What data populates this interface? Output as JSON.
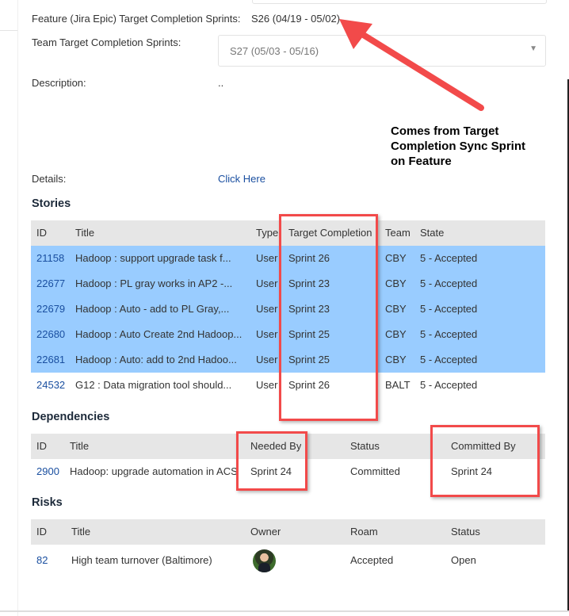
{
  "fields": {
    "feature_label": "Feature (Jira Epic) Target Completion Sprints:",
    "feature_value": "S26 (04/19 - 05/02)",
    "team_label": "Team Target Completion Sprints:",
    "team_value": "S27 (05/03 - 05/16)",
    "description_label": "Description:",
    "description_value": "..",
    "details_label": "Details:",
    "details_link": "Click Here"
  },
  "annotation": {
    "text": "Comes from Target Completion Sync Sprint on Feature",
    "color": "#f24a4a"
  },
  "stories": {
    "title": "Stories",
    "columns": [
      "ID",
      "Title",
      "Type",
      "Target Completion",
      "Team",
      "State"
    ],
    "rows": [
      {
        "id": "21158",
        "title": "Hadoop : support upgrade task f...",
        "type": "User",
        "target": "Sprint 26",
        "team": "CBY",
        "state": "5 - Accepted",
        "selected": true
      },
      {
        "id": "22677",
        "title": "Hadoop : PL gray works in AP2 -...",
        "type": "User",
        "target": "Sprint 23",
        "team": "CBY",
        "state": "5 - Accepted",
        "selected": true
      },
      {
        "id": "22679",
        "title": "Hadoop : Auto - add to PL Gray,...",
        "type": "User",
        "target": "Sprint 23",
        "team": "CBY",
        "state": "5 - Accepted",
        "selected": true
      },
      {
        "id": "22680",
        "title": "Hadoop : Auto Create 2nd Hadoop...",
        "type": "User",
        "target": "Sprint 25",
        "team": "CBY",
        "state": "5 - Accepted",
        "selected": true
      },
      {
        "id": "22681",
        "title": "Hadoop : Auto: add to 2nd Hadoo...",
        "type": "User",
        "target": "Sprint 25",
        "team": "CBY",
        "state": "5 - Accepted",
        "selected": true
      },
      {
        "id": "24532",
        "title": "G12 : Data migration tool should...",
        "type": "User",
        "target": "Sprint 26",
        "team": "BALT",
        "state": "5 - Accepted",
        "selected": false
      }
    ]
  },
  "dependencies": {
    "title": "Dependencies",
    "columns": [
      "ID",
      "Title",
      "Needed By",
      "Status",
      "Committed By"
    ],
    "rows": [
      {
        "id": "2900",
        "title": "Hadoop: upgrade automation in ACS",
        "needed": "Sprint 24",
        "status": "Committed",
        "committed": "Sprint 24"
      }
    ]
  },
  "risks": {
    "title": "Risks",
    "columns": [
      "ID",
      "Title",
      "Owner",
      "Roam",
      "Status"
    ],
    "rows": [
      {
        "id": "82",
        "title": "High team turnover (Baltimore)",
        "owner": "avatar",
        "roam": "Accepted",
        "status": "Open"
      }
    ]
  }
}
